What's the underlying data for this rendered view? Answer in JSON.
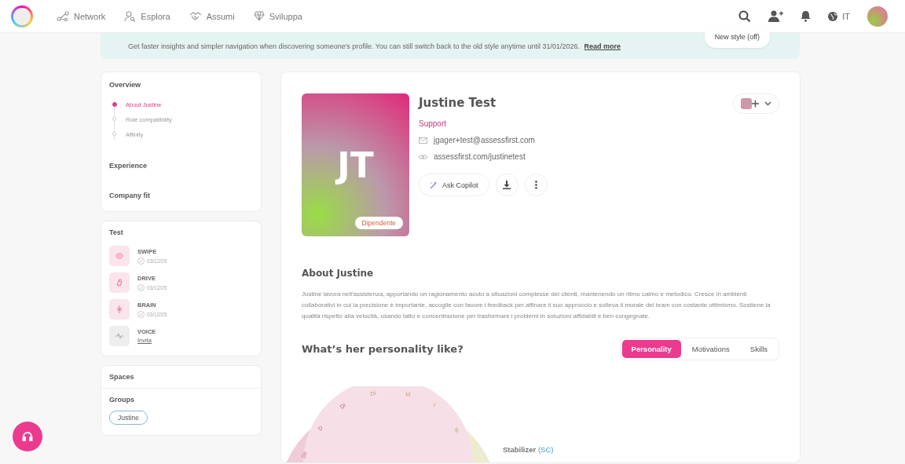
{
  "nav": {
    "items": [
      {
        "label": "Network"
      },
      {
        "label": "Esplora"
      },
      {
        "label": "Assumi"
      },
      {
        "label": "Sviluppa"
      }
    ],
    "language": "IT"
  },
  "banner": {
    "text": "Get faster insights and simpler navigation when discovering someone's profile. You can still switch back to the old style anytime until 31/01/2026.",
    "link": "Read more",
    "toggle": "New style (off)"
  },
  "overview": {
    "title": "Overview",
    "items": [
      {
        "label": "About Justine",
        "selected": true
      },
      {
        "label": "Role compatibility",
        "selected": false
      },
      {
        "label": "Affinity",
        "selected": false
      }
    ],
    "sections": [
      "Experience",
      "Company fit"
    ]
  },
  "tests": {
    "title": "Test",
    "items": [
      {
        "name": "SWIPE",
        "kind": "done",
        "date": "03/12/25"
      },
      {
        "name": "DRIVE",
        "kind": "done",
        "date": "03/12/25"
      },
      {
        "name": "BRAIN",
        "kind": "done",
        "date": "03/12/25"
      },
      {
        "name": "VOICE",
        "kind": "invite",
        "action": "Invita"
      }
    ]
  },
  "spaces": {
    "title": "Spaces"
  },
  "groups": {
    "title": "Groups",
    "tags": [
      "Justine"
    ]
  },
  "profile": {
    "initials": "JT",
    "badge": "Dipendente",
    "name": "Justine Test",
    "role": "Support",
    "email": "jgager+test@assessfirst.com",
    "url": "assessfirst.com/justinetest",
    "copilot": "Ask Copilot"
  },
  "about": {
    "title": "About Justine",
    "text": "Justine lavora nell'assistenza, apportando un ragionamento acuto a situazioni complesse dei clienti, mantenendo un ritmo calmo e metodico. Cresce in ambienti collaborativi in cui la precisione è importante, accoglie con favore i feedback per affinare il suo approccio e solleva il morale del team con costante ottimismo. Sostiene la qualità rispetto alla velocità, usando tatto e concentrazione per trasformare i problemi in soluzioni affidabili e ben congegnate."
  },
  "personality": {
    "title": "What’s her personality like?",
    "tabs": [
      {
        "label": "Personality",
        "selected": true
      },
      {
        "label": "Motivations",
        "selected": false
      },
      {
        "label": "Skills",
        "selected": false
      }
    ],
    "wheel_labels": [
      "Dc",
      "D",
      "Di",
      "Di",
      "Id",
      "I",
      "Is"
    ],
    "profile_type": "Stabilizer",
    "profile_code": "(SC)"
  }
}
